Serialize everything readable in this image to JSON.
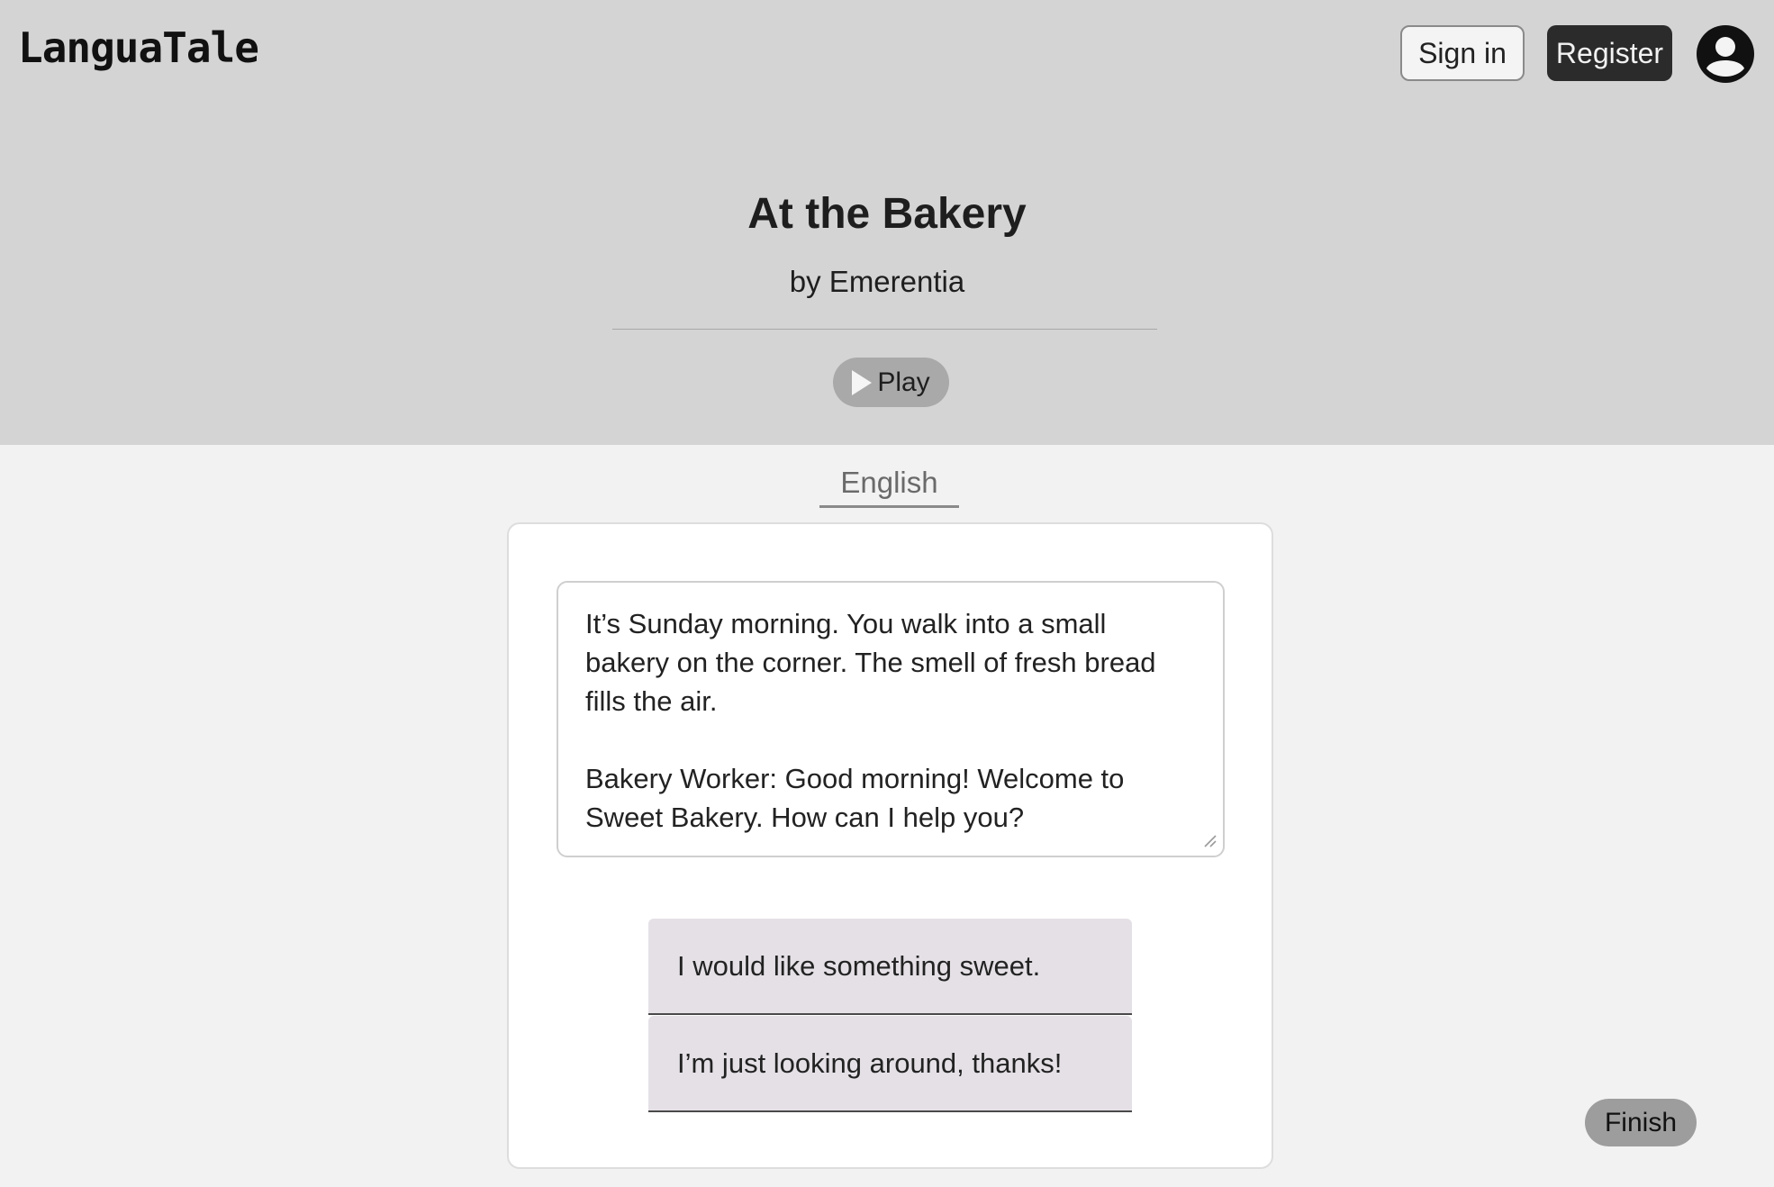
{
  "header": {
    "logo": "LanguaTale",
    "signin_label": "Sign in",
    "register_label": "Register",
    "avatar_icon": "user-circle-icon",
    "background": "#d4d4d4"
  },
  "story": {
    "title": "At the Bakery",
    "author": "by Emerentia",
    "play_label": "Play",
    "play_icon": "play-icon"
  },
  "language_tab": "English",
  "content": {
    "text": "It’s Sunday morning. You walk into a small bakery on the corner. The smell of fresh bread fills the air.\n\nBakery Worker: Good morning! Welcome to Sweet Bakery. How can I help you?"
  },
  "choices": [
    {
      "label": "I would like something sweet."
    },
    {
      "label": "I’m just looking around, thanks!"
    }
  ],
  "finish_label": "Finish"
}
